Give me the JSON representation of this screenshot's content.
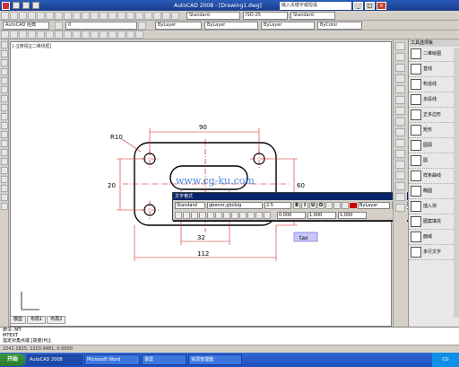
{
  "window": {
    "title": "AutoCAD 2008 - [Drawing1.dwg]",
    "search_placeholder": "输入关键字或短语",
    "min": "_",
    "max": "□",
    "close": "×"
  },
  "toolbar2": {
    "workspace": "AutoCAD 经典",
    "layer": "0",
    "color": "ByLayer",
    "linetype": "ByLayer",
    "lineweight": "ByLayer",
    "plotstyle": "ByColor"
  },
  "toolbar3": {
    "textstyle": "Standard",
    "dimstyle": "ISO-25",
    "tablestyle": "Standard"
  },
  "drawing": {
    "title": "[-][俯视][二维线框]",
    "dims": {
      "top": "90",
      "left": "20",
      "bottom_small": "32",
      "bottom_large": "112",
      "radius": "R10",
      "right": "60"
    },
    "watermark": "www.cg-ku.com"
  },
  "tabs": [
    "模型",
    "布局1",
    "布局2"
  ],
  "editor": {
    "title": "文字格式",
    "style": "Standard",
    "font": "gbenor,gbcbig",
    "height": "2.5",
    "color_name": "ByLayer",
    "ok_label": "确定",
    "btn_bold": "B",
    "btn_italic": "I",
    "btn_underline": "U",
    "btn_overline": "O",
    "spacing_1": "0.000",
    "spacing_2": "1.000",
    "spacing_3": "1.000",
    "input_text": "tax"
  },
  "command": {
    "line1": "命令: MT",
    "line2": "MTEXT",
    "line3": "指定对角点或 [高度(H)]:"
  },
  "status": {
    "coords": "2241.1825, 1203.9481, 0.0000"
  },
  "palette": {
    "title": "工具选项板",
    "items": [
      "二维绘图",
      "直线",
      "构造线",
      "多段线",
      "正多边形",
      "矩形",
      "圆弧",
      "圆",
      "样条曲线",
      "椭圆",
      "插入块",
      "图案填充",
      "面域",
      "多行文字"
    ]
  },
  "taskbar": {
    "start": "开始",
    "tasks": [
      "AutoCAD 2008",
      "Microsoft Word",
      "录屏",
      "资源管理器"
    ],
    "tray": "CG"
  },
  "colors": {
    "title_bar": "#1a3c8c",
    "drawing_lines": "#c00000",
    "dimension": "#d42020",
    "watermark": "#1060d0"
  }
}
